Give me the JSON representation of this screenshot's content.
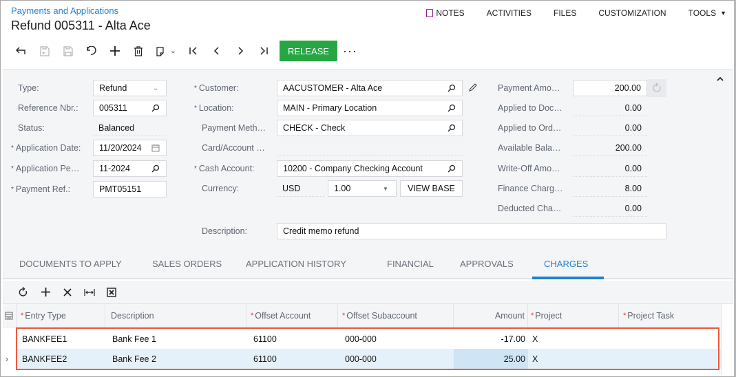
{
  "header": {
    "breadcrumb": "Payments and Applications",
    "title": "Refund 005311 - Alta Ace"
  },
  "topnav": {
    "notes": "NOTES",
    "activities": "ACTIVITIES",
    "files": "FILES",
    "customization": "CUSTOMIZATION",
    "tools": "TOOLS"
  },
  "toolbar": {
    "release_label": "RELEASE",
    "more_label": "···",
    "icons": [
      "back-icon",
      "save-close-icon",
      "save-icon",
      "undo-icon",
      "add-icon",
      "delete-icon",
      "copy-paste-icon",
      "first-record-icon",
      "previous-record-icon",
      "next-record-icon",
      "last-record-icon"
    ]
  },
  "form": {
    "left": {
      "type_label": "Type:",
      "type_value": "Refund",
      "refnbr_label": "Reference Nbr.:",
      "refnbr_value": "005311",
      "status_label": "Status:",
      "status_value": "Balanced",
      "appdate_label": "Application Date:",
      "appdate_value": "11/20/2024",
      "appperiod_label": "Application Pe…",
      "appperiod_value": "11-2024",
      "payref_label": "Payment Ref.:",
      "payref_value": "PMT05151"
    },
    "middle": {
      "customer_label": "Customer:",
      "customer_value": "AACUSTOMER - Alta Ace",
      "location_label": "Location:",
      "location_value": "MAIN - Primary Location",
      "paymethod_label": "Payment Meth…",
      "paymethod_value": "CHECK - Check",
      "card_label": "Card/Account …",
      "card_value": "",
      "cash_label": "Cash Account:",
      "cash_value": "10200 - Company Checking Account",
      "currency_label": "Currency:",
      "currency_value": "USD",
      "rate_value": "1.00",
      "viewbase_label": "VIEW BASE",
      "description_label": "Description:",
      "description_value": "Credit memo refund"
    },
    "right": {
      "payment_amount_label": "Payment Amo…",
      "payment_amount_value": "200.00",
      "applied_doc_label": "Applied to Doc…",
      "applied_doc_value": "0.00",
      "applied_ord_label": "Applied to Ord…",
      "applied_ord_value": "0.00",
      "available_label": "Available Bala…",
      "available_value": "200.00",
      "writeoff_label": "Write-Off Amo…",
      "writeoff_value": "0.00",
      "finance_label": "Finance Charg…",
      "finance_value": "8.00",
      "deducted_label": "Deducted Cha…",
      "deducted_value": "0.00"
    }
  },
  "tabs": [
    {
      "label": "DOCUMENTS TO APPLY"
    },
    {
      "label": "SALES ORDERS"
    },
    {
      "label": "APPLICATION HISTORY"
    },
    {
      "label": "FINANCIAL"
    },
    {
      "label": "APPROVALS"
    },
    {
      "label": "CHARGES",
      "active": true
    }
  ],
  "grid": {
    "columns": [
      {
        "label": "Entry Type",
        "required": true
      },
      {
        "label": "Description",
        "required": false
      },
      {
        "label": "Offset Account",
        "required": true
      },
      {
        "label": "Offset Subaccount",
        "required": true
      },
      {
        "label": "Amount",
        "required": false
      },
      {
        "label": "Project",
        "required": true
      },
      {
        "label": "Project Task",
        "required": true
      }
    ],
    "rows": [
      {
        "entry_type": "BANKFEE1",
        "description": "Bank Fee 1",
        "offset_account": "61100",
        "offset_subaccount": "000-000",
        "amount": "-17.00",
        "project": "X",
        "project_task": ""
      },
      {
        "entry_type": "BANKFEE2",
        "description": "Bank Fee 2",
        "offset_account": "61100",
        "offset_subaccount": "000-000",
        "amount": "25.00",
        "project": "X",
        "project_task": "",
        "selected": true
      }
    ]
  },
  "colors": {
    "accent": "#1f7fd4",
    "release": "#27a743",
    "highlight": "#f05a3b",
    "selected_row": "#e5f1fa",
    "selected_cell": "#cfe4f4"
  }
}
